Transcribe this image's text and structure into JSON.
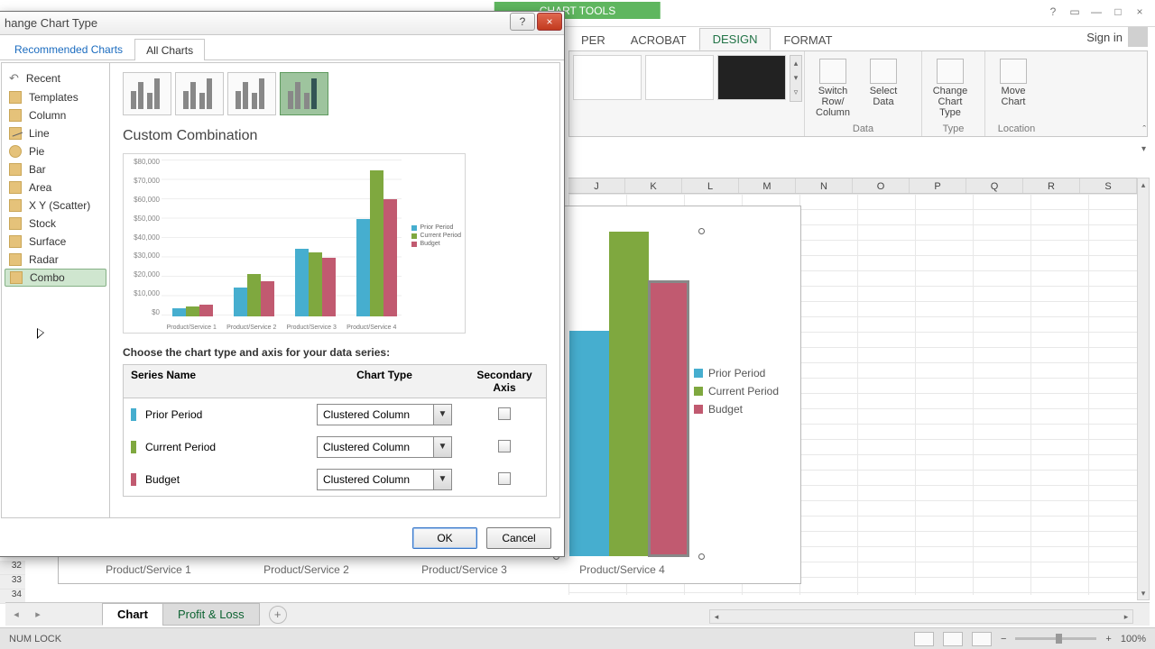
{
  "excel": {
    "chart_tools": "CHART TOOLS",
    "tabs": {
      "per": "PER",
      "acrobat": "ACROBAT",
      "design": "DESIGN",
      "format": "FORMAT"
    },
    "sign_in": "Sign in",
    "ribbon_groups": {
      "data": "Data",
      "type": "Type",
      "location": "Location",
      "switch": "Switch Row/\nColumn",
      "select": "Select\nData",
      "change": "Change\nChart Type",
      "move": "Move\nChart"
    },
    "columns": [
      "J",
      "K",
      "L",
      "M",
      "N",
      "O",
      "P",
      "Q",
      "R",
      "S"
    ],
    "rows_visible": [
      "32",
      "33",
      "34"
    ],
    "sheet_tabs": {
      "active": "Chart",
      "other": "Profit & Loss"
    },
    "status": {
      "numlock": "NUM LOCK",
      "zoom": "100%"
    },
    "legend": [
      "Prior Period",
      "Current Period",
      "Budget"
    ],
    "x_labels": [
      "Product/Service 1",
      "Product/Service 2",
      "Product/Service 3",
      "Product/Service 4"
    ]
  },
  "dialog": {
    "title": "hange Chart Type",
    "tabs": {
      "recommended": "Recommended Charts",
      "all": "All Charts"
    },
    "categories": [
      "Recent",
      "Templates",
      "Column",
      "Line",
      "Pie",
      "Bar",
      "Area",
      "X Y (Scatter)",
      "Stock",
      "Surface",
      "Radar",
      "Combo"
    ],
    "subtitle": "Custom Combination",
    "series_instruction": "Choose the chart type and axis for your data series:",
    "headers": {
      "name": "Series Name",
      "type": "Chart Type",
      "secondary": "Secondary Axis"
    },
    "series": [
      {
        "name": "Prior Period",
        "chart_type": "Clustered Column",
        "secondary": false,
        "color": "#46aecf"
      },
      {
        "name": "Current Period",
        "chart_type": "Clustered Column",
        "secondary": false,
        "color": "#7fa83f"
      },
      {
        "name": "Budget",
        "chart_type": "Clustered Column",
        "secondary": false,
        "color": "#c15a70"
      }
    ],
    "buttons": {
      "ok": "OK",
      "cancel": "Cancel"
    }
  },
  "chart_data": {
    "type": "bar",
    "title": "",
    "xlabel": "",
    "ylabel": "",
    "ylim": [
      0,
      80000
    ],
    "categories": [
      "Product/Service 1",
      "Product/Service 2",
      "Product/Service 3",
      "Product/Service 4"
    ],
    "series": [
      {
        "name": "Prior Period",
        "values": [
          4000,
          15000,
          35000,
          50000
        ]
      },
      {
        "name": "Current Period",
        "values": [
          5000,
          22000,
          33000,
          75000
        ]
      },
      {
        "name": "Budget",
        "values": [
          6000,
          18000,
          30000,
          60000
        ]
      }
    ],
    "y_ticks": [
      "$80,000",
      "$70,000",
      "$60,000",
      "$50,000",
      "$40,000",
      "$30,000",
      "$20,000",
      "$10,000",
      "$0"
    ]
  }
}
